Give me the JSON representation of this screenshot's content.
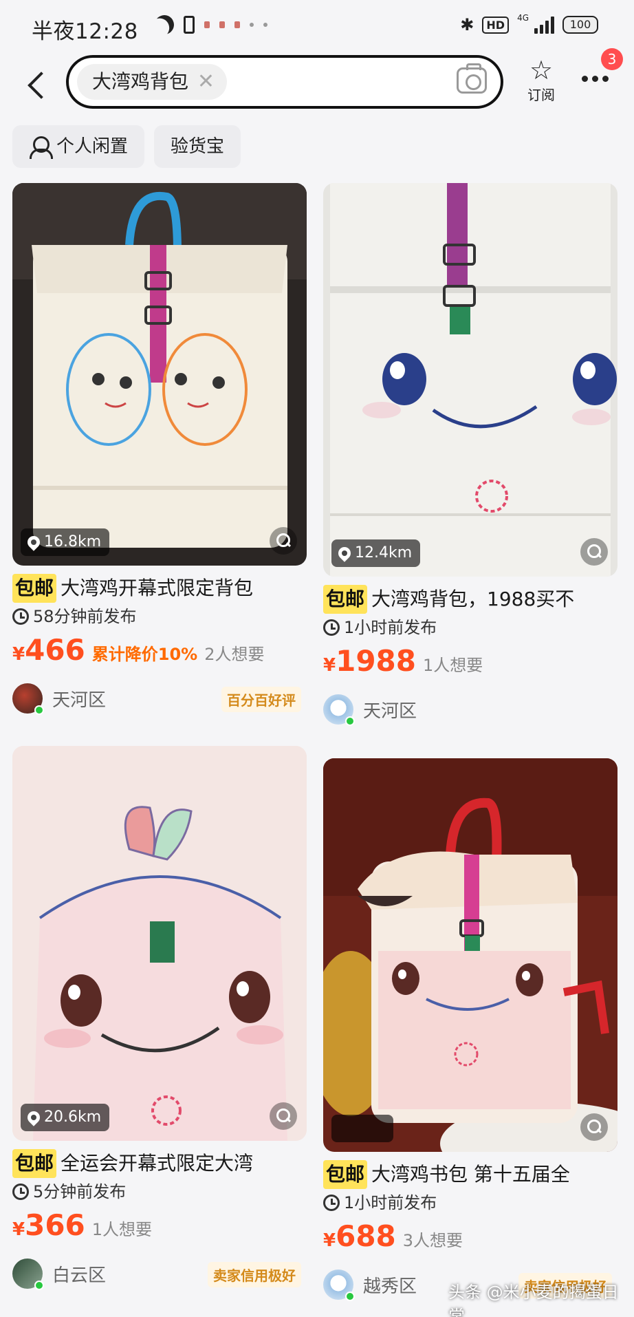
{
  "status_bar": {
    "time": "半夜12:28",
    "network": "4G",
    "battery": "100",
    "hd": "HD"
  },
  "search": {
    "query": "大湾鸡背包",
    "clear_icon": "close-icon",
    "camera_icon": "camera-icon"
  },
  "header": {
    "subscribe_label": "订阅",
    "more_badge": "3"
  },
  "filters": [
    {
      "label": "个人闲置",
      "icon": "person-icon"
    },
    {
      "label": "验货宝"
    }
  ],
  "listings": [
    {
      "distance": "16.8km",
      "tag": "包邮",
      "title": "大湾鸡开幕式限定背包",
      "posted": "58分钟前发布",
      "currency": "¥",
      "price": "466",
      "price_drop": "累计降价10%",
      "wants": "2人想要",
      "area": "天河区",
      "seller_badge": "百分百好评",
      "colors": {
        "bg": "#2b2624",
        "bag": "#f3eee2"
      }
    },
    {
      "distance": "12.4km",
      "tag": "包邮",
      "title": "大湾鸡背包，1988买不",
      "posted": "1小时前发布",
      "currency": "¥",
      "price": "1988",
      "wants": "1人想要",
      "area": "天河区",
      "colors": {
        "bg": "#e6e5e1",
        "bag": "#f2f1ed"
      }
    },
    {
      "distance": "20.6km",
      "tag": "包邮",
      "title": "全运会开幕式限定大湾",
      "posted": "5分钟前发布",
      "currency": "¥",
      "price": "366",
      "wants": "1人想要",
      "area": "白云区",
      "seller_badge": "卖家信用极好",
      "colors": {
        "bg": "#f2ebe7",
        "bag": "#f4e6e3"
      }
    },
    {
      "distance": "",
      "tag": "包邮",
      "title": "大湾鸡书包 第十五届全",
      "posted": "1小时前发布",
      "currency": "¥",
      "price": "688",
      "wants": "3人想要",
      "area": "越秀区",
      "seller_badge": "卖家信用极好",
      "colors": {
        "bg": "#6a2319",
        "bag": "#f6ece3"
      }
    }
  ],
  "watermark": "头条 @米小麦的揭蛋日常"
}
